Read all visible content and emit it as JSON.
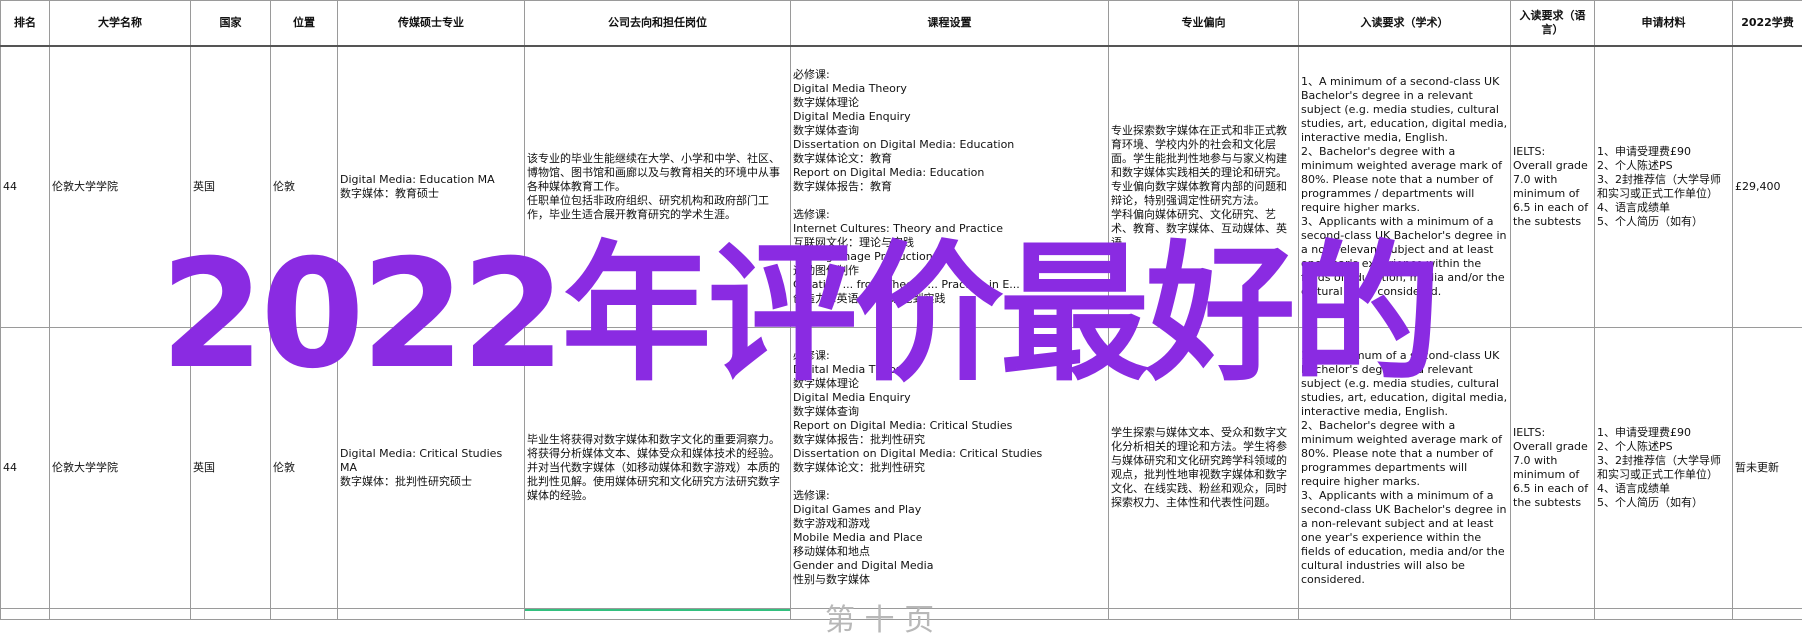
{
  "headers": [
    "排名",
    "大学名称",
    "国家",
    "位置",
    "传媒硕士专业",
    "公司去向和担任岗位",
    "课程设置",
    "专业偏向",
    "入读要求（学术）",
    "入读要求（语言）",
    "申请材料",
    "2022学费"
  ],
  "rows": [
    {
      "rank": "44",
      "university": "伦敦大学学院",
      "country": "英国",
      "location": "伦敦",
      "major": [
        "Digital Media: Education MA",
        "数字媒体：教育硕士"
      ],
      "career": [
        "该专业的毕业生能继续在大学、小学和中学、社区、博物馆、图书馆和画廊以及与教育相关的环境中从事各种媒体教育工作。",
        "任职单位包括非政府组织、研究机构和政府部门工作，毕业生适合展开教育研究的学术生涯。"
      ],
      "courses": [
        "必修课:",
        "Digital Media Theory",
        "数字媒体理论",
        "Digital Media Enquiry",
        "数字媒体查询",
        "Dissertation on Digital Media: Education",
        "数字媒体论文：教育",
        "Report on Digital Media: Education",
        "数字媒体报告：教育",
        "",
        "选修课:",
        "Internet Cultures: Theory and Practice",
        "互联网文化：理论与实践",
        "Moving Image Production",
        "运动图像制作",
        "Creative ... from Theory ... Practice in E... Media ... a",
        "创造力...英语...戏...理论到实践"
      ],
      "focus": [
        "专业探索数字媒体在正式和非正式教育环境、学校内外的社会和文化层面。学生能批判性地参与与家义构建和数字媒体实践相关的理论和研究。",
        "专业偏向数字媒体教育内部的问题和辩论，特别强调定性研究方法。",
        "学科偏向媒体研究、文化研究、艺术、教育、数字媒体、互动媒体、英语。"
      ],
      "academic": [
        "1、A minimum of a second-class UK Bachelor's degree in a relevant subject (e.g. media studies, cultural studies, art, education, digital media, interactive media, English.",
        "2、Bachelor's degree with a minimum weighted average mark of 80%. Please note that a number of programmes / departments will require higher marks.",
        "3、Applicants with a minimum of a second-class UK Bachelor's degree in a non-relevant subject and at least one year's experience within the fields of education, media and/or the cultural ... be considered."
      ],
      "language": [
        "IELTS:",
        "Overall grade 7.0 with minimum of 6.5 in each of the subtests"
      ],
      "materials": [
        "1、申请受理费£90",
        "2、个人陈述PS",
        "3、2封推荐信（大学导师和实习或正式工作单位）",
        "4、语言成绩单",
        "5、个人简历（如有）"
      ],
      "fee": "£29,400"
    },
    {
      "rank": "44",
      "university": "伦敦大学学院",
      "country": "英国",
      "location": "伦敦",
      "major": [
        "Digital Media: Critical Studies MA",
        "数字媒体：批判性研究硕士"
      ],
      "career": [
        "毕业生将获得对数字媒体和数字文化的重要洞察力。将获得分析媒体文本、媒体受众和媒体技术的经验。并对当代数字媒体（如移动媒体和数字游戏）本质的批判性见解。使用媒体研究和文化研究方法研究数字媒体的经验。"
      ],
      "courses": [
        "必修课:",
        "Digital Media Theory",
        "数字媒体理论",
        "Digital Media Enquiry",
        "数字媒体查询",
        "Report on Digital Media: Critical Studies",
        "数字媒体报告：批判性研究",
        "Dissertation on Digital Media: Critical Studies",
        "数字媒体论文：批判性研究",
        "",
        "选修课:",
        "Digital Games and Play",
        "数字游戏和游戏",
        "Mobile Media and Place",
        "移动媒体和地点",
        "Gender and Digital Media",
        "性别与数字媒体"
      ],
      "focus": [
        "学生探索与媒体文本、受众和数字文化分析相关的理论和方法。学生将参与媒体研究和文化研究跨学科领域的观点，批判性地审视数字媒体和数字文化、在线实践、粉丝和观众，同时探索权力、主体性和代表性问题。"
      ],
      "academic": [
        "1、A minimum of a second-class UK Bachelor's degree in a relevant subject (e.g. media studies, cultural studies, art, education, digital media, interactive media, English.",
        "2、Bachelor's degree with a minimum weighted average mark of 80%. Please note that a number of programmes departments will require higher marks.",
        "3、Applicants with a minimum of a second-class UK Bachelor's degree in a non-relevant subject and at least one year's experience within the fields of education, media and/or the cultural industries will also be considered."
      ],
      "language": [
        "IELTS:",
        "Overall grade 7.0 with minimum of 6.5 in each of the subtests"
      ],
      "materials": [
        "1、申请受理费£90",
        "2、个人陈述PS",
        "3、2封推荐信（大学导师和实习或正式工作单位）",
        "4、语言成绩单",
        "5、个人简历（如有）"
      ],
      "fee": "暂未更新"
    }
  ],
  "watermark": "2022年评价最好的",
  "bottom_ghost": "第 十 页",
  "colors": {
    "watermark": "#8a2be2",
    "grid": "#9a9a9a",
    "selection": "#33c07f"
  }
}
